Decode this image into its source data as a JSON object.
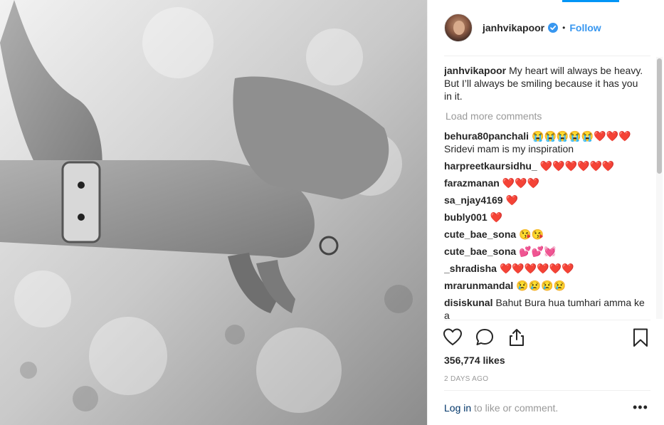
{
  "post": {
    "username": "janhvikapoor",
    "follow_label": "Follow",
    "dot": "•",
    "caption_user": "janhvikapoor",
    "caption_text": "My heart will always be heavy. But I’ll always be smiling because it has you in it.",
    "load_more": "Load more comments",
    "likes": "356,774 likes",
    "time": "2 DAYS AGO",
    "login_link": "Log in",
    "login_suffix": " to like or comment.",
    "more_label": "•••"
  },
  "comments": [
    {
      "user": "behura80panchali",
      "text": "😭😭😭😭😭❤️❤️❤️ Sridevi mam is my inspiration"
    },
    {
      "user": "harpreetkaursidhu_",
      "text": "❤️❤️❤️❤️❤️❤️"
    },
    {
      "user": "farazmanan",
      "text": "❤️❤️❤️"
    },
    {
      "user": "sa_njay4169",
      "text": "❤️"
    },
    {
      "user": "bubly001",
      "text": "❤️"
    },
    {
      "user": "cute_bae_sona",
      "text": "😘😘"
    },
    {
      "user": "cute_bae_sona",
      "text": "💕💕💓"
    },
    {
      "user": "_shradisha",
      "text": "❤️❤️❤️❤️❤️❤️"
    },
    {
      "user": "mrarunmandal",
      "text": "😢😢😢😢"
    },
    {
      "user": "disiskunal",
      "text": "Bahut Bura hua tumhari amma ke a"
    }
  ],
  "colors": {
    "accent": "#3897f0",
    "login": "#003569",
    "muted": "#999999"
  },
  "icons": [
    "verified-icon",
    "heart-icon",
    "comment-icon",
    "share-icon",
    "bookmark-icon"
  ]
}
